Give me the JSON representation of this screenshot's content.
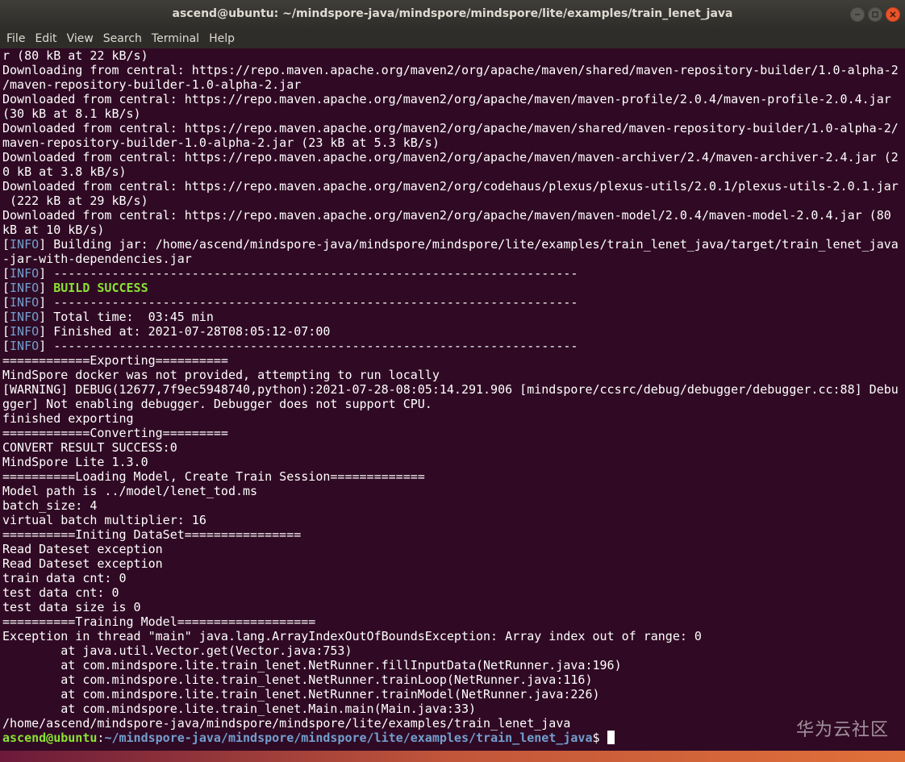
{
  "window": {
    "title": "ascend@ubuntu: ~/mindspore-java/mindspore/mindspore/lite/examples/train_lenet_java"
  },
  "menu": [
    "File",
    "Edit",
    "View",
    "Search",
    "Terminal",
    "Help"
  ],
  "colors": {
    "background": "#300a24",
    "text": "#ffffff",
    "info": "#729fcf",
    "success": "#8ae234",
    "prompt_user": "#8ae234",
    "prompt_path": "#729fcf"
  },
  "terminal": {
    "lines": [
      {
        "text": "r (80 kB at 22 kB/s)"
      },
      {
        "text": "Downloading from central: https://repo.maven.apache.org/maven2/org/apache/maven/shared/maven-repository-builder/1.0-alpha-2"
      },
      {
        "text": "/maven-repository-builder-1.0-alpha-2.jar"
      },
      {
        "text": "Downloaded from central: https://repo.maven.apache.org/maven2/org/apache/maven/maven-profile/2.0.4/maven-profile-2.0.4.jar"
      },
      {
        "text": "(30 kB at 8.1 kB/s)"
      },
      {
        "text": "Downloaded from central: https://repo.maven.apache.org/maven2/org/apache/maven/shared/maven-repository-builder/1.0-alpha-2/"
      },
      {
        "text": "maven-repository-builder-1.0-alpha-2.jar (23 kB at 5.3 kB/s)"
      },
      {
        "text": "Downloaded from central: https://repo.maven.apache.org/maven2/org/apache/maven/maven-archiver/2.4/maven-archiver-2.4.jar (2"
      },
      {
        "text": "0 kB at 3.8 kB/s)"
      },
      {
        "text": "Downloaded from central: https://repo.maven.apache.org/maven2/org/codehaus/plexus/plexus-utils/2.0.1/plexus-utils-2.0.1.jar"
      },
      {
        "text": " (222 kB at 29 kB/s)"
      },
      {
        "text": "Downloaded from central: https://repo.maven.apache.org/maven2/org/apache/maven/maven-model/2.0.4/maven-model-2.0.4.jar (80"
      },
      {
        "text": "kB at 10 kB/s)"
      },
      {
        "tag": "INFO",
        "text": " Building jar: /home/ascend/mindspore-java/mindspore/mindspore/lite/examples/train_lenet_java/target/train_lenet_java"
      },
      {
        "text": "-jar-with-dependencies.jar"
      },
      {
        "tag": "INFO",
        "text": " ------------------------------------------------------------------------"
      },
      {
        "tag": "INFO",
        "text": " ",
        "success": "BUILD SUCCESS"
      },
      {
        "tag": "INFO",
        "text": " ------------------------------------------------------------------------"
      },
      {
        "tag": "INFO",
        "text": " Total time:  03:45 min"
      },
      {
        "tag": "INFO",
        "text": " Finished at: 2021-07-28T08:05:12-07:00"
      },
      {
        "tag": "INFO",
        "text": " ------------------------------------------------------------------------"
      },
      {
        "text": "============Exporting=========="
      },
      {
        "text": "MindSpore docker was not provided, attempting to run locally"
      },
      {
        "text": "[WARNING] DEBUG(12677,7f9ec5948740,python):2021-07-28-08:05:14.291.906 [mindspore/ccsrc/debug/debugger/debugger.cc:88] Debu"
      },
      {
        "text": "gger] Not enabling debugger. Debugger does not support CPU."
      },
      {
        "text": "finished exporting"
      },
      {
        "text": "============Converting========="
      },
      {
        "text": "CONVERT RESULT SUCCESS:0"
      },
      {
        "text": "MindSpore Lite 1.3.0"
      },
      {
        "text": "==========Loading Model, Create Train Session============="
      },
      {
        "text": "Model path is ../model/lenet_tod.ms"
      },
      {
        "text": "batch_size: 4"
      },
      {
        "text": "virtual batch multiplier: 16"
      },
      {
        "text": "==========Initing DataSet================"
      },
      {
        "text": "Read Dateset exception"
      },
      {
        "text": "Read Dateset exception"
      },
      {
        "text": "train data cnt: 0"
      },
      {
        "text": "test data cnt: 0"
      },
      {
        "text": "test data size is 0"
      },
      {
        "text": "==========Training Model==================="
      },
      {
        "text": "Exception in thread \"main\" java.lang.ArrayIndexOutOfBoundsException: Array index out of range: 0"
      },
      {
        "text": "        at java.util.Vector.get(Vector.java:753)"
      },
      {
        "text": "        at com.mindspore.lite.train_lenet.NetRunner.fillInputData(NetRunner.java:196)"
      },
      {
        "text": "        at com.mindspore.lite.train_lenet.NetRunner.trainLoop(NetRunner.java:116)"
      },
      {
        "text": "        at com.mindspore.lite.train_lenet.NetRunner.trainModel(NetRunner.java:226)"
      },
      {
        "text": "        at com.mindspore.lite.train_lenet.Main.main(Main.java:33)"
      },
      {
        "text": "/home/ascend/mindspore-java/mindspore/mindspore/lite/examples/train_lenet_java"
      }
    ],
    "prompt": {
      "user": "ascend@ubuntu",
      "sep": ":",
      "path": "~/mindspore-java/mindspore/mindspore/lite/examples/train_lenet_java",
      "symbol": "$"
    }
  },
  "watermark": "华为云社区"
}
